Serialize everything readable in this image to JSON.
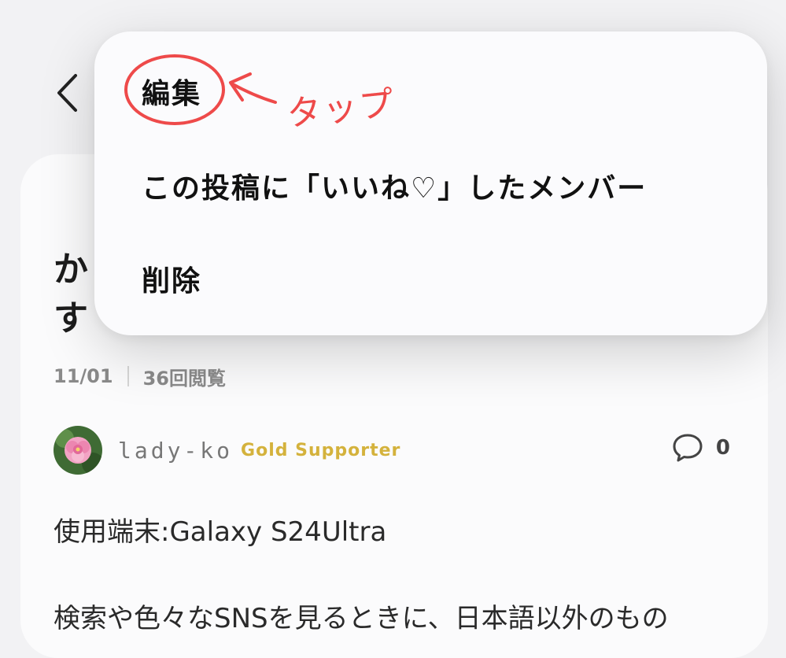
{
  "post": {
    "title_line1": "か",
    "title_line2": "す",
    "date": "11/01",
    "views": "36回閲覧",
    "author": {
      "username": "lady-ko",
      "rank": "Gold Supporter"
    },
    "comment_count": "0",
    "body_line1": "使用端末:Galaxy S24Ultra",
    "body_line2": "検索や色々なSNSを見るときに、日本語以外のもの"
  },
  "menu": {
    "edit": "編集",
    "liked_members": "この投稿に「いいね♡」したメンバー",
    "delete": "削除"
  },
  "annotation": {
    "text": "タップ",
    "color": "#ee4a4a"
  },
  "icons": {
    "back": "chevron-left-icon",
    "comment": "speech-bubble-icon"
  }
}
